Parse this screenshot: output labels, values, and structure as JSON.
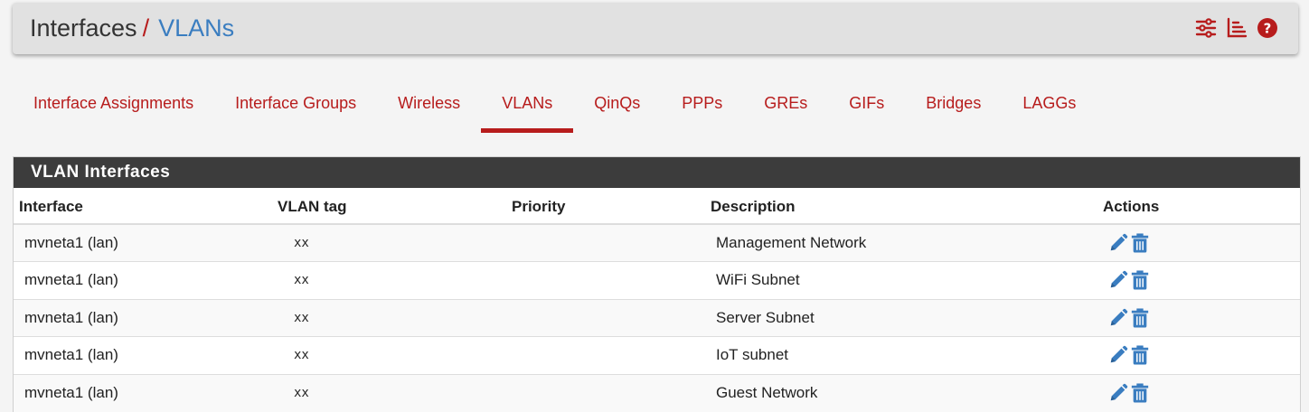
{
  "breadcrumb": {
    "parent": "Interfaces",
    "separator": "/",
    "current": "VLANs"
  },
  "header_icons": [
    "sliders-icon",
    "list-chart-icon",
    "help-icon"
  ],
  "tabs": [
    {
      "label": "Interface Assignments",
      "active": false
    },
    {
      "label": "Interface Groups",
      "active": false
    },
    {
      "label": "Wireless",
      "active": false
    },
    {
      "label": "VLANs",
      "active": true
    },
    {
      "label": "QinQs",
      "active": false
    },
    {
      "label": "PPPs",
      "active": false
    },
    {
      "label": "GREs",
      "active": false
    },
    {
      "label": "GIFs",
      "active": false
    },
    {
      "label": "Bridges",
      "active": false
    },
    {
      "label": "LAGGs",
      "active": false
    }
  ],
  "panel": {
    "title": "VLAN Interfaces",
    "columns": [
      "Interface",
      "VLAN tag",
      "Priority",
      "Description",
      "Actions"
    ],
    "rows": [
      {
        "interface": "mvneta1 (lan)",
        "vlan_tag": "xx",
        "priority": "",
        "description": "Management Network"
      },
      {
        "interface": "mvneta1 (lan)",
        "vlan_tag": "xx",
        "priority": "",
        "description": "WiFi Subnet"
      },
      {
        "interface": "mvneta1 (lan)",
        "vlan_tag": "xx",
        "priority": "",
        "description": "Server Subnet"
      },
      {
        "interface": "mvneta1 (lan)",
        "vlan_tag": "xx",
        "priority": "",
        "description": "IoT subnet"
      },
      {
        "interface": "mvneta1 (lan)",
        "vlan_tag": "xx",
        "priority": "",
        "description": "Guest Network"
      }
    ],
    "row_actions": [
      "pencil-icon",
      "trash-icon"
    ]
  },
  "colors": {
    "accent_red": "#b71c1c",
    "link_blue": "#3a7dc0",
    "panel_heading": "#3c3c3c",
    "action_blue": "#3a7dc0"
  }
}
